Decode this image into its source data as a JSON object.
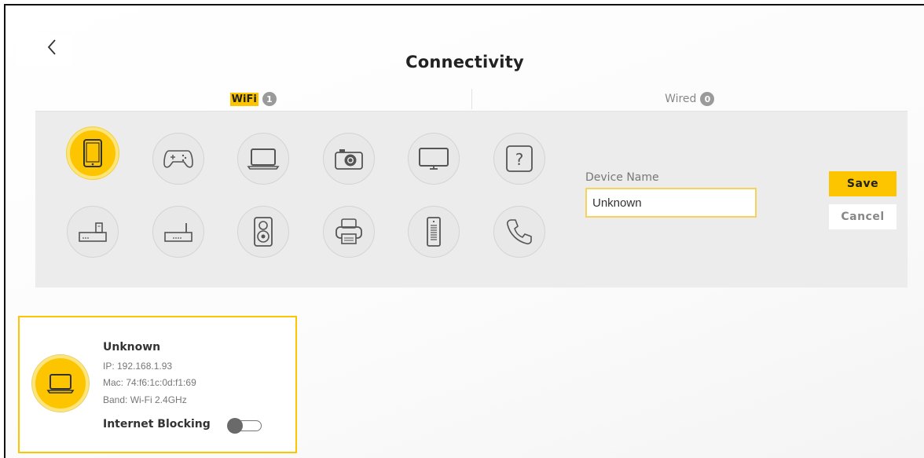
{
  "page": {
    "title": "Connectivity"
  },
  "tabs": [
    {
      "label": "WiFi",
      "count": "1",
      "active": true
    },
    {
      "label": "Wired",
      "count": "0",
      "active": false
    }
  ],
  "device_types": [
    {
      "name": "tablet-icon",
      "selected": true
    },
    {
      "name": "gamepad-icon",
      "selected": false
    },
    {
      "name": "laptop-icon",
      "selected": false
    },
    {
      "name": "camera-icon",
      "selected": false
    },
    {
      "name": "monitor-icon",
      "selected": false
    },
    {
      "name": "question-icon",
      "selected": false
    },
    {
      "name": "modem-icon",
      "selected": false
    },
    {
      "name": "router-icon",
      "selected": false
    },
    {
      "name": "speaker-icon",
      "selected": false
    },
    {
      "name": "printer-icon",
      "selected": false
    },
    {
      "name": "server-icon",
      "selected": false
    },
    {
      "name": "phone-icon",
      "selected": false
    }
  ],
  "form": {
    "device_name_label": "Device Name",
    "device_name_value": "Unknown",
    "save_label": "Save",
    "cancel_label": "Cancel"
  },
  "device_card": {
    "name": "Unknown",
    "ip": "IP: 192.168.1.93",
    "mac": "Mac: 74:f6:1c:0d:f1:69",
    "band": "Band: Wi-Fi 2.4GHz",
    "blocking_label": "Internet Blocking",
    "blocking_enabled": false,
    "icon": "laptop-icon"
  },
  "colors": {
    "accent": "#fcc500",
    "panel": "#ececec",
    "badge": "#9a9a9a"
  }
}
